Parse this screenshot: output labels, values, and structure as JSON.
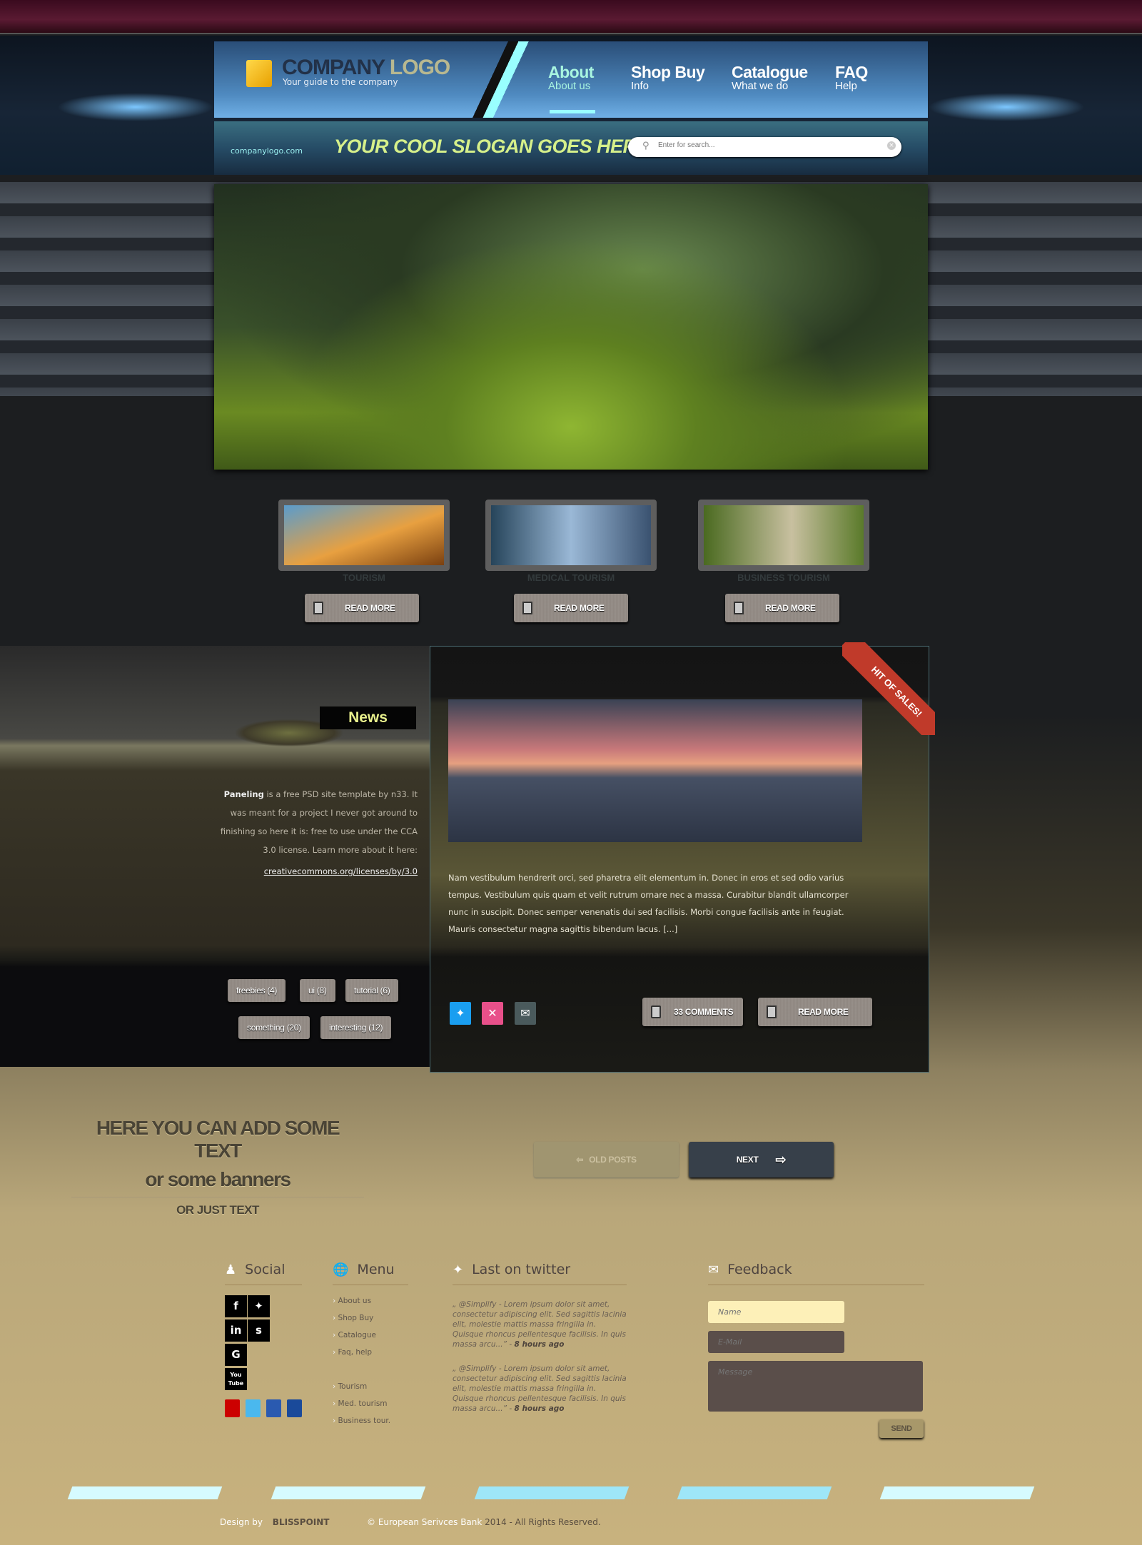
{
  "header": {
    "logo": {
      "company": "COMPANY",
      "logo": "LOGO",
      "tagline": "Your guide to the company"
    },
    "nav": [
      {
        "title": "About",
        "subtitle": "About us",
        "active": true
      },
      {
        "title": "Shop Buy",
        "subtitle": "Info"
      },
      {
        "title": "Catalogue",
        "subtitle": "What we do"
      },
      {
        "title": "FAQ",
        "subtitle": "Help"
      }
    ],
    "site_url": "companylogo.com",
    "slogan": "YOUR COOL SLOGAN GOES HERE",
    "search": {
      "placeholder": "Enter for search...",
      "icon": "search-icon",
      "clear_icon": "clear-icon"
    }
  },
  "features": [
    {
      "caption": "TOURISM",
      "button": "READ MORE"
    },
    {
      "caption": "MEDICAL TOURISM",
      "button": "READ MORE"
    },
    {
      "caption": "BUSINESS TOURISM",
      "button": "READ MORE"
    }
  ],
  "news": {
    "label": "News",
    "intro_bold": "Paneling",
    "intro": " is a free PSD site template by n33. It was meant for a project I never got around to finishing so here it is: free to use under the CCA 3.0 license. Learn more about it here:",
    "link": "creativecommons.org/licenses/by/3.0",
    "tags": [
      "freebies (4)",
      "ui (8)",
      "tutorial (6)",
      "something (20)",
      "interesting (12)"
    ]
  },
  "article": {
    "ribbon": "HIT OF SALES!",
    "text": "Nam vestibulum hendrerit orci, sed pharetra elit elementum in. Donec in eros et sed odio varius tempus. Vestibulum quis quam et velit rutrum ornare nec a massa. Curabitur blandit ullamcorper nunc in suscipit. Donec semper venenatis dui sed facilisis. Morbi congue facilisis ante in feugiat. Mauris consectetur magna sagittis bibendum lacus. [...]",
    "share_icons": [
      "twitter-icon",
      "dribbble-icon",
      "mail-icon"
    ],
    "comments": "33 COMMENTS",
    "read_more": "READ MORE"
  },
  "promo": {
    "line1": "HERE YOU CAN ADD SOME TEXT",
    "line2": "or some banners",
    "line3": "OR JUST TEXT"
  },
  "pagination": {
    "old": "OLD POSTS",
    "next": "NEXT"
  },
  "footer": {
    "social": {
      "title": "Social",
      "icons": [
        "f",
        "t",
        "in",
        "s",
        "G",
        "You Tube"
      ],
      "small_icons": [
        "youtube-icon",
        "twitter-icon",
        "facebook-icon",
        "linkedin-icon"
      ]
    },
    "menu": {
      "title": "Menu",
      "items": [
        "About us",
        "Shop Buy",
        "Catalogue",
        "Faq, help"
      ],
      "items2": [
        "Tourism",
        "Med. tourism",
        "Business tour."
      ]
    },
    "twitter": {
      "title": "Last on twitter",
      "tweets": [
        {
          "text": "„ @Simplify - Lorem ipsum dolor sit amet, consectetur adipiscing elit. Sed sagittis lacinia elit, molestie mattis massa fringilla in. Quisque rhoncus pellentesque facilisis. In quis massa arcu...” - ",
          "time": "8 hours ago"
        },
        {
          "text": "„ @Simplify - Lorem ipsum dolor sit amet, consectetur adipiscing elit. Sed sagittis lacinia elit, molestie mattis massa fringilla in. Quisque rhoncus pellentesque facilisis. In quis massa arcu...” - ",
          "time": "8 hours ago"
        }
      ]
    },
    "feedback": {
      "title": "Feedback",
      "name_placeholder": "Name",
      "email_placeholder": "E-Mail",
      "message_placeholder": "Message",
      "send": "SEND"
    },
    "credit": "Design by",
    "credit_logo": "BLISSPOINT",
    "copyright_a": "© European Serivces Bank",
    "copyright_b": " 2014 - All Rights Reserved."
  },
  "colors": {
    "accent": "#9ffff0",
    "slogan": "#d6f08a",
    "ribbon": "#c03a2a",
    "news_label": "#e8f08c"
  }
}
